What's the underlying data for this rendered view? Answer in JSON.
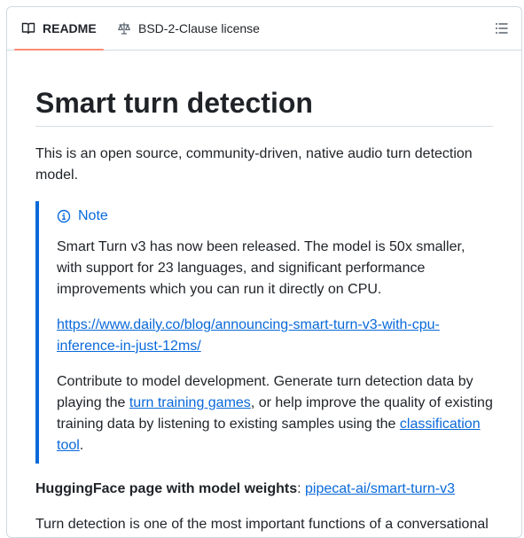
{
  "tabs": {
    "readme": "README",
    "license": "BSD-2-Clause license"
  },
  "icons": {
    "readme": "book-icon",
    "license": "law-icon",
    "outline": "list-unordered-icon",
    "note": "info-icon"
  },
  "colors": {
    "accent": "#0969da",
    "tab_underline": "#fd8c73",
    "text": "#1f2328"
  },
  "readme": {
    "title": "Smart turn detection",
    "intro": "This is an open source, community-driven, native audio turn detection model.",
    "note": {
      "title": "Note",
      "p1": "Smart Turn v3 has now been released. The model is 50x smaller, with support for 23 languages, and significant performance improvements which you can run it directly on CPU.",
      "link": "https://www.daily.co/blog/announcing-smart-turn-v3-with-cpu-inference-in-just-12ms/",
      "p3_a": "Contribute to model development. Generate turn detection data by playing the ",
      "p3_link1": "turn training games",
      "p3_b": ", or help improve the quality of existing training data by listening to existing samples using the ",
      "p3_link2": "classification tool",
      "p3_c": "."
    },
    "hf_label": "HuggingFace page with model weights",
    "hf_sep": ": ",
    "hf_link": "pipecat-ai/smart-turn-v3",
    "turn_text": "Turn detection is one of the most important functions of a conversational"
  }
}
